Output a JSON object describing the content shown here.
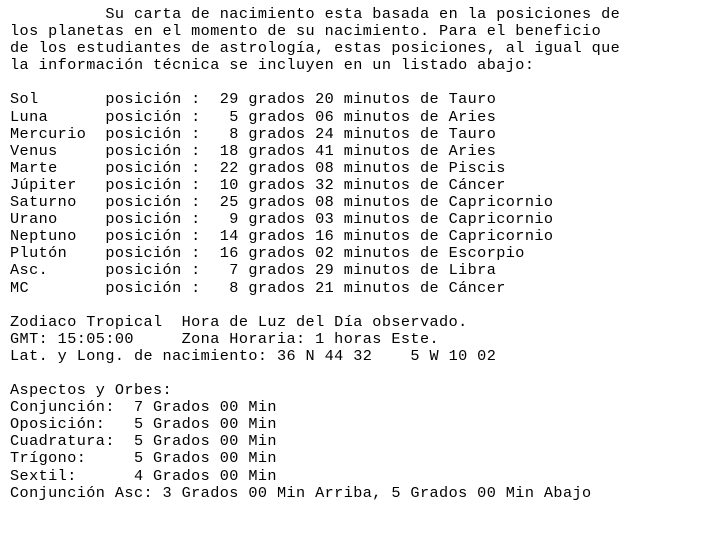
{
  "document": {
    "kind": "astrology-birth-chart-report",
    "language": "es",
    "background_color": "#ffffff",
    "text_color": "#000000"
  },
  "intro": {
    "lines": [
      "          Su carta de nacimiento esta basada en la posiciones de",
      "los planetas en el momento de su nacimiento. Para el beneficio",
      "de los estudiantes de astrología, estas posiciones, al igual que",
      "la información técnica se incluyen en un listado abajo:"
    ]
  },
  "positions": {
    "label_posicion": "posición",
    "label_colon": ":",
    "label_grados": "grados",
    "label_minutos": "minutos",
    "label_de": "de",
    "rows": [
      {
        "body": "Sol",
        "degrees": "29",
        "minutes": "20",
        "sign": "Tauro",
        "line": "Sol       posición :  29 grados 20 minutos de Tauro"
      },
      {
        "body": "Luna",
        "degrees": "5",
        "minutes": "06",
        "sign": "Aries",
        "line": "Luna      posición :   5 grados 06 minutos de Aries"
      },
      {
        "body": "Mercurio",
        "degrees": "8",
        "minutes": "24",
        "sign": "Tauro",
        "line": "Mercurio  posición :   8 grados 24 minutos de Tauro"
      },
      {
        "body": "Venus",
        "degrees": "18",
        "minutes": "41",
        "sign": "Aries",
        "line": "Venus     posición :  18 grados 41 minutos de Aries"
      },
      {
        "body": "Marte",
        "degrees": "22",
        "minutes": "08",
        "sign": "Piscis",
        "line": "Marte     posición :  22 grados 08 minutos de Piscis"
      },
      {
        "body": "Júpiter",
        "degrees": "10",
        "minutes": "32",
        "sign": "Cáncer",
        "line": "Júpiter   posición :  10 grados 32 minutos de Cáncer"
      },
      {
        "body": "Saturno",
        "degrees": "25",
        "minutes": "08",
        "sign": "Capricornio",
        "line": "Saturno   posición :  25 grados 08 minutos de Capricornio"
      },
      {
        "body": "Urano",
        "degrees": "9",
        "minutes": "03",
        "sign": "Capricornio",
        "line": "Urano     posición :   9 grados 03 minutos de Capricornio"
      },
      {
        "body": "Neptuno",
        "degrees": "14",
        "minutes": "16",
        "sign": "Capricornio",
        "line": "Neptuno   posición :  14 grados 16 minutos de Capricornio"
      },
      {
        "body": "Plutón",
        "degrees": "16",
        "minutes": "02",
        "sign": "Escorpio",
        "line": "Plutón    posición :  16 grados 02 minutos de Escorpio"
      },
      {
        "body": "Asc.",
        "degrees": "7",
        "minutes": "29",
        "sign": "Libra",
        "line": "Asc.      posición :   7 grados 29 minutos de Libra"
      },
      {
        "body": "MC",
        "degrees": "8",
        "minutes": "21",
        "sign": "Cáncer",
        "line": "MC        posición :   8 grados 21 minutos de Cáncer"
      }
    ]
  },
  "technical": {
    "zodiac_system": "Zodiaco Tropical",
    "daylight_note": "Hora de Luz del Día observado.",
    "gmt_label": "GMT:",
    "gmt_value": "15:05:00",
    "timezone_label": "Zona Horaria:",
    "timezone_value": "1 horas Este.",
    "latlong_label": "Lat. y Long. de nacimiento:",
    "latitude": "36 N 44 32",
    "longitude": "5 W 10 02",
    "lines": [
      "Zodiaco Tropical  Hora de Luz del Día observado.",
      "GMT: 15:05:00     Zona Horaria: 1 horas Este.",
      "Lat. y Long. de nacimiento: 36 N 44 32    5 W 10 02"
    ]
  },
  "aspects": {
    "heading": "Aspectos y Orbes:",
    "unit_grados": "Grados",
    "unit_min": "Min",
    "rows": [
      {
        "name": "Conjunción:",
        "degrees": "7",
        "minutes": "00",
        "line": "Conjunción:  7 Grados 00 Min"
      },
      {
        "name": "Oposición:",
        "degrees": "5",
        "minutes": "00",
        "line": "Oposición:   5 Grados 00 Min"
      },
      {
        "name": "Cuadratura:",
        "degrees": "5",
        "minutes": "00",
        "line": "Cuadratura:  5 Grados 00 Min"
      },
      {
        "name": "Trígono:",
        "degrees": "5",
        "minutes": "00",
        "line": "Trígono:     5 Grados 00 Min"
      },
      {
        "name": "Sextil:",
        "degrees": "4",
        "minutes": "00",
        "line": "Sextil:      4 Grados 00 Min"
      }
    ],
    "asc_conjunction": {
      "name": "Conjunción Asc:",
      "above_degrees": "3",
      "above_minutes": "00",
      "above_label": "Arriba,",
      "below_degrees": "5",
      "below_minutes": "00",
      "below_label": "Abajo",
      "line": "Conjunción Asc: 3 Grados 00 Min Arriba, 5 Grados 00 Min Abajo"
    }
  }
}
